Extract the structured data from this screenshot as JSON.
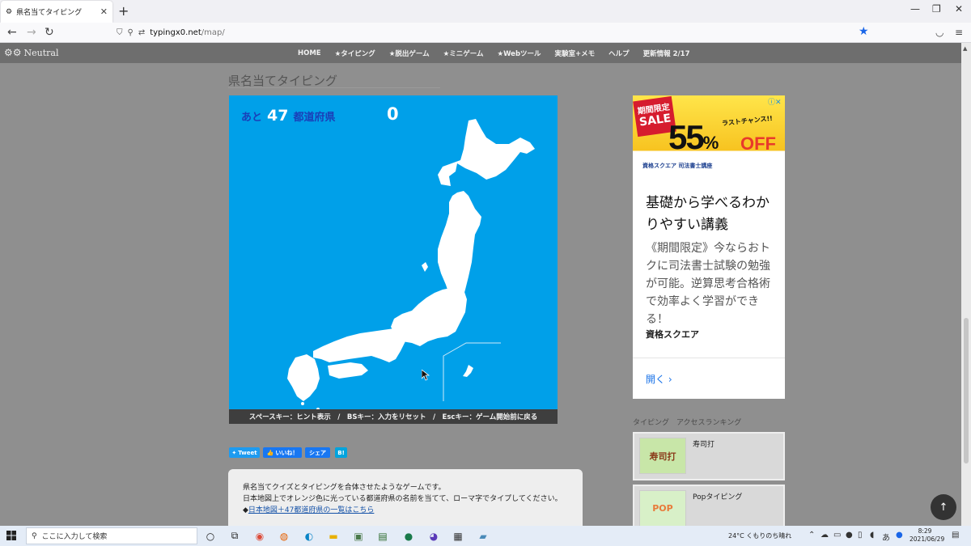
{
  "browser": {
    "tab_title": "県名当てタイピング",
    "url_host": "typingx0.net",
    "url_path": "/map/",
    "accent": "#1a66e8"
  },
  "site": {
    "logo_text": "Neutral",
    "nav": [
      "HOME",
      "★タイピング",
      "★脱出ゲーム",
      "★ミニゲーム",
      "★Webツール",
      "実験室+メモ",
      "ヘルプ",
      "更新情報 2/17"
    ],
    "page_title": "県名当てタイピング"
  },
  "game": {
    "remaining_prefix": "あと",
    "remaining_count": "47",
    "remaining_suffix": "都道府県",
    "score": "0",
    "footer_help": "スペースキー：ヒント表示　/　BSキー：入力をリセット　/　Escキー：ゲーム開始前に戻る",
    "background": "#00a0e9",
    "map_color": "#ffffff"
  },
  "share": {
    "tweet": "Tweet",
    "like": "いいね！",
    "share": "シェア",
    "hatena": "B!"
  },
  "description": {
    "line1": "県名当てクイズとタイピングを合体させたようなゲームです。",
    "line2": "日本地図上でオレンジ色に光っている都道府県の名前を当てて、ローマ字でタイプしてください。",
    "link_prefix": "◆",
    "link_text": "日本地図＋47都道府県の一覧はこちら"
  },
  "ad": {
    "badge_line1": "期間限定",
    "badge_line2": "SALE",
    "big_number": "55",
    "percent": "%",
    "off": "OFF",
    "last_chance": "ラストチャンス!!",
    "provider": "資格スクエア 司法書士講座",
    "headline": "基礎から学べるわかりやすい講義",
    "body": "《期間限定》今ならおトクに司法書士試験の勉強が可能。逆算思考合格術で効率よく学習ができる！",
    "advertiser": "資格スクエア",
    "open": "開く ›"
  },
  "ranking": {
    "heading": "タイピング　アクセスランキング",
    "items": [
      {
        "name": "寿司打",
        "thumb": "寿司打"
      },
      {
        "name": "Popタイピング",
        "thumb": "POP"
      }
    ]
  },
  "taskbar": {
    "search_placeholder": "ここに入力して検索",
    "weather": "24°C くもりのち晴れ",
    "time": "8:29",
    "date": "2021/06/29"
  }
}
